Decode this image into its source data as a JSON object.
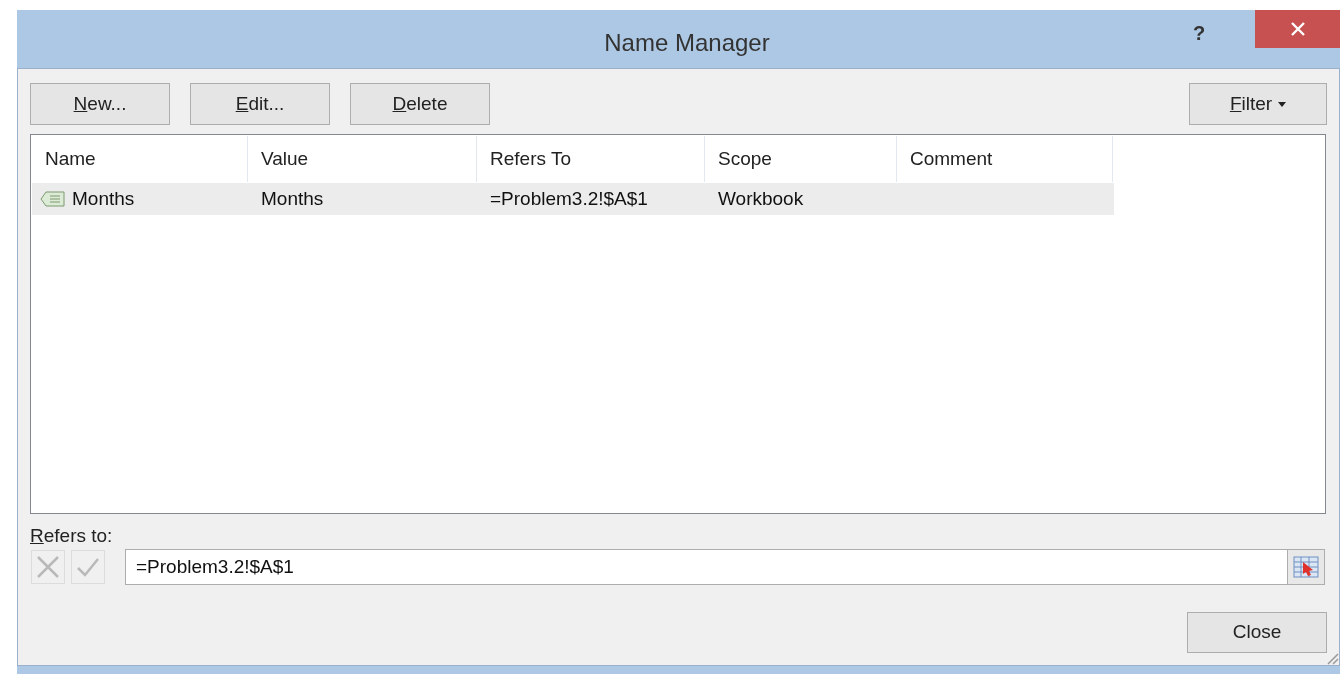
{
  "window": {
    "title": "Name Manager",
    "help": "?"
  },
  "buttons": [
    {
      "label": "New...",
      "mnemonic_underlined": true
    },
    {
      "label": "Edit...",
      "mnemonic_underlined": true
    },
    {
      "label": "Delete",
      "mnemonic_underlined": true
    }
  ],
  "filter": {
    "label": "Filter",
    "mnemonic_underlined": true
  },
  "table": {
    "columns": [
      "Name",
      "Value",
      "Refers To",
      "Scope",
      "Comment"
    ],
    "rows": [
      {
        "selected": false,
        "cells": [
          "Months",
          "Months",
          "=Problem3.2!$A$1",
          "Workbook",
          ""
        ]
      }
    ]
  },
  "refers_to": {
    "label": "Refers to:",
    "mnemonic_underlined": true,
    "value": "=Problem3.2!$A$1"
  },
  "close_button": {
    "label": "Close"
  }
}
